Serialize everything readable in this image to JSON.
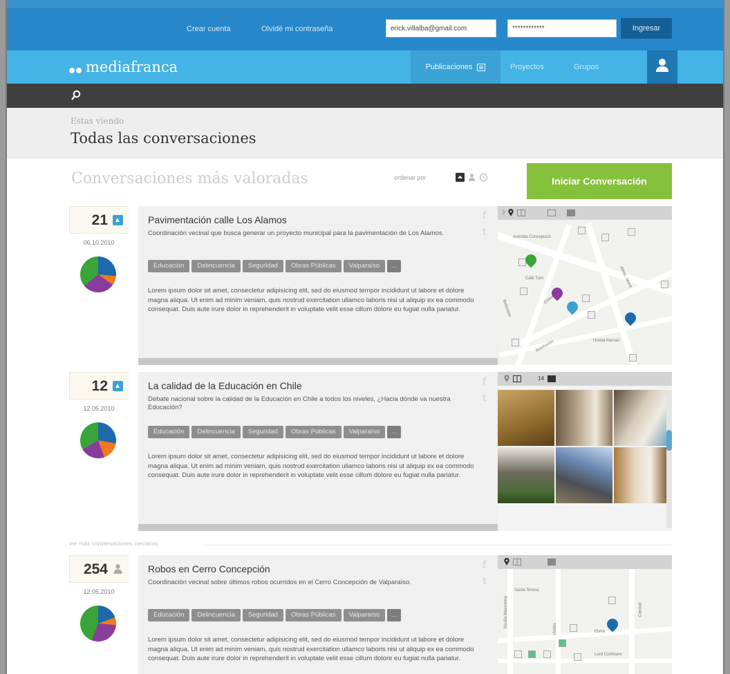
{
  "header": {
    "create_account": "Crear cuenta",
    "forgot_password": "Olvidé mi contraseña",
    "email_value": "erick.villalba@gmail.com",
    "password_value": "************",
    "login_label": "Ingresar"
  },
  "nav": {
    "logo": "mediafranca",
    "items": [
      "Publicaciones",
      "Proyectos",
      "Grupos"
    ]
  },
  "page": {
    "viewing_label": "Estas viendo",
    "title": "Todas las conversaciones"
  },
  "section": {
    "title": "Conversaciones más valoradas",
    "sort_label": "ordenar por",
    "start_button": "Iniciar Conversación",
    "see_more": "ver más conversaciones cercanas"
  },
  "tags": [
    "Educación",
    "Delincuencia",
    "Seguridad",
    "Obras Públicas",
    "Valparaíso",
    "..."
  ],
  "lorem": "Lorem ipsum dolor sit amet, consectetur adipisicing elit, sed do eiusmod tempor incididunt ut labore et dolore magna aliqua. Ut enim ad minim veniam, quis nostrud exercitation ullamco laboris nisi ut aliquip ex ea commodo consequat. Duis aute irure dolor in reprehenderit in voluptate velit esse cillum dolore eu fugiat nulla pariatur.",
  "conversations": [
    {
      "score": "21",
      "date": "06.10.2010",
      "title": "Pavimentación calle Los Alamos",
      "description": "Coordinación vecinal que busca generar un proyecto municipal para la pavimentación de Los Alamos.",
      "media_count": "3",
      "map_labels": [
        "Avenida Concepción",
        "Café Turri",
        "Concepción",
        "Bellavista",
        "Beethoven",
        "Hostal Aleman",
        "Almte. Montt"
      ]
    },
    {
      "score": "12",
      "date": "12.05.2010",
      "title": "La calidad de la Educación en Chile",
      "description": "Debate nacional sobre la calidad de la Educación en Chile a todos los niveles, ¿Hacia dónde va nuestra Educación?",
      "media_count": "14"
    },
    {
      "score": "254",
      "date": "12.05.2010",
      "title": "Robos en Cerro Concepción",
      "description": "Coordinación vecinal sobre últimos robos ocurridos en el Cerro Concepción de Valparaíso.",
      "map_labels": [
        "Santa Teresa",
        "Vicuña Mackenna",
        "Elvira",
        "Caridad",
        "Urriola",
        "Lord Cochrane"
      ]
    }
  ],
  "colors": {
    "topbar": "#2787c8",
    "navbar": "#44b3e5",
    "accent_green": "#86c13b",
    "pie_blue": "#1c6aa9",
    "pie_orange": "#f07a1f",
    "pie_purple": "#8a3c9c",
    "pie_green": "#3aa43a"
  }
}
